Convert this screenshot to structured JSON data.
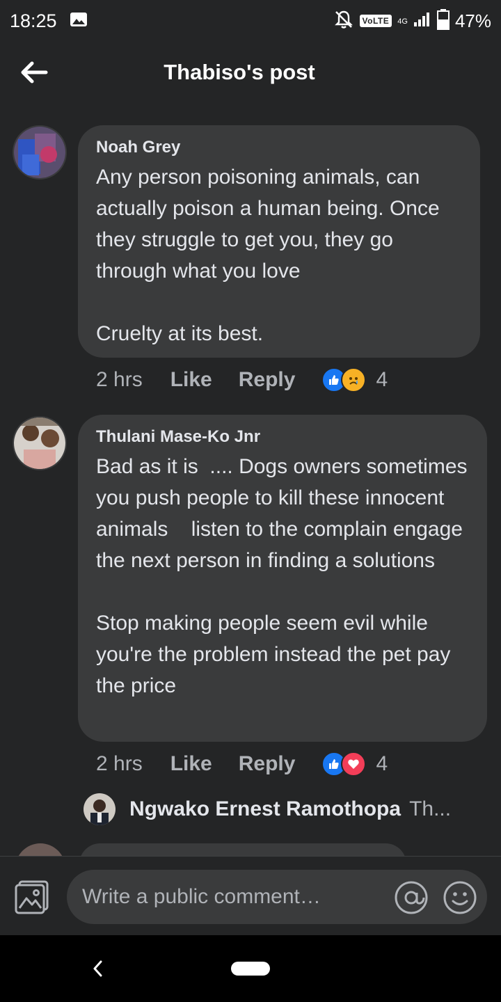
{
  "status_bar": {
    "time": "18:25",
    "volte": "VoLTE",
    "network": "4G",
    "battery": "47%"
  },
  "header": {
    "title": "Thabiso's post"
  },
  "comments": [
    {
      "name": "Noah Grey",
      "text": "Any person poisoning animals, can actually poison a human being. Once they struggle to get you, they go through what you love\n\nCruelty at its best.",
      "time": "2 hrs",
      "like_label": "Like",
      "reply_label": "Reply",
      "reactions": [
        "like",
        "sad"
      ],
      "reaction_count": "4"
    },
    {
      "name": "Thulani Mase-Ko Jnr",
      "text": "Bad as it is  .... Dogs owners sometimes you push people to kill these innocent animals    listen to the complain engage the next person in finding a solutions\n\nStop making people seem evil while you're the problem instead the pet pay the price",
      "time": "2 hrs",
      "like_label": "Like",
      "reply_label": "Reply",
      "reactions": [
        "like",
        "love"
      ],
      "reaction_count": "4",
      "reply_preview": {
        "name": "Ngwako Ernest Ramothopa",
        "snippet": "Th..."
      }
    }
  ],
  "composer": {
    "placeholder": "Write a public comment…"
  },
  "colors": {
    "background": "#242526",
    "bubble": "#3a3b3c",
    "like_blue": "#1877f2",
    "love_red": "#f33e58",
    "sad_yellow": "#f7b125"
  }
}
